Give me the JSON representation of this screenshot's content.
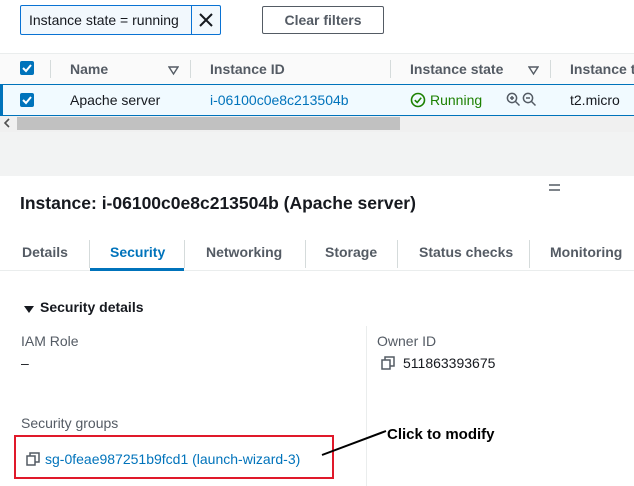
{
  "filter": {
    "token_text": "Instance state = running",
    "clear_label": "Clear filters"
  },
  "table": {
    "headers": {
      "name": "Name",
      "instance_id": "Instance ID",
      "instance_state": "Instance state",
      "instance_type": "Instance t"
    },
    "row": {
      "name": "Apache server",
      "instance_id": "i-06100c0e8c213504b",
      "state": "Running",
      "type": "t2.micro"
    }
  },
  "detail": {
    "title": "Instance: i-06100c0e8c213504b (Apache server)",
    "tabs": [
      "Details",
      "Security",
      "Networking",
      "Storage",
      "Status checks",
      "Monitoring"
    ],
    "active_tab": "Security",
    "section_title": "Security details",
    "iam_role_label": "IAM Role",
    "iam_role_value": "–",
    "owner_id_label": "Owner ID",
    "owner_id_value": "511863393675",
    "security_groups_label": "Security groups",
    "security_group_link": "sg-0feae987251b9fcd1 (launch-wizard-3)"
  },
  "annotation": {
    "text": "Click to modify"
  },
  "colors": {
    "link": "#0073bb",
    "running": "#1d8102",
    "highlight": "#e0192a"
  }
}
